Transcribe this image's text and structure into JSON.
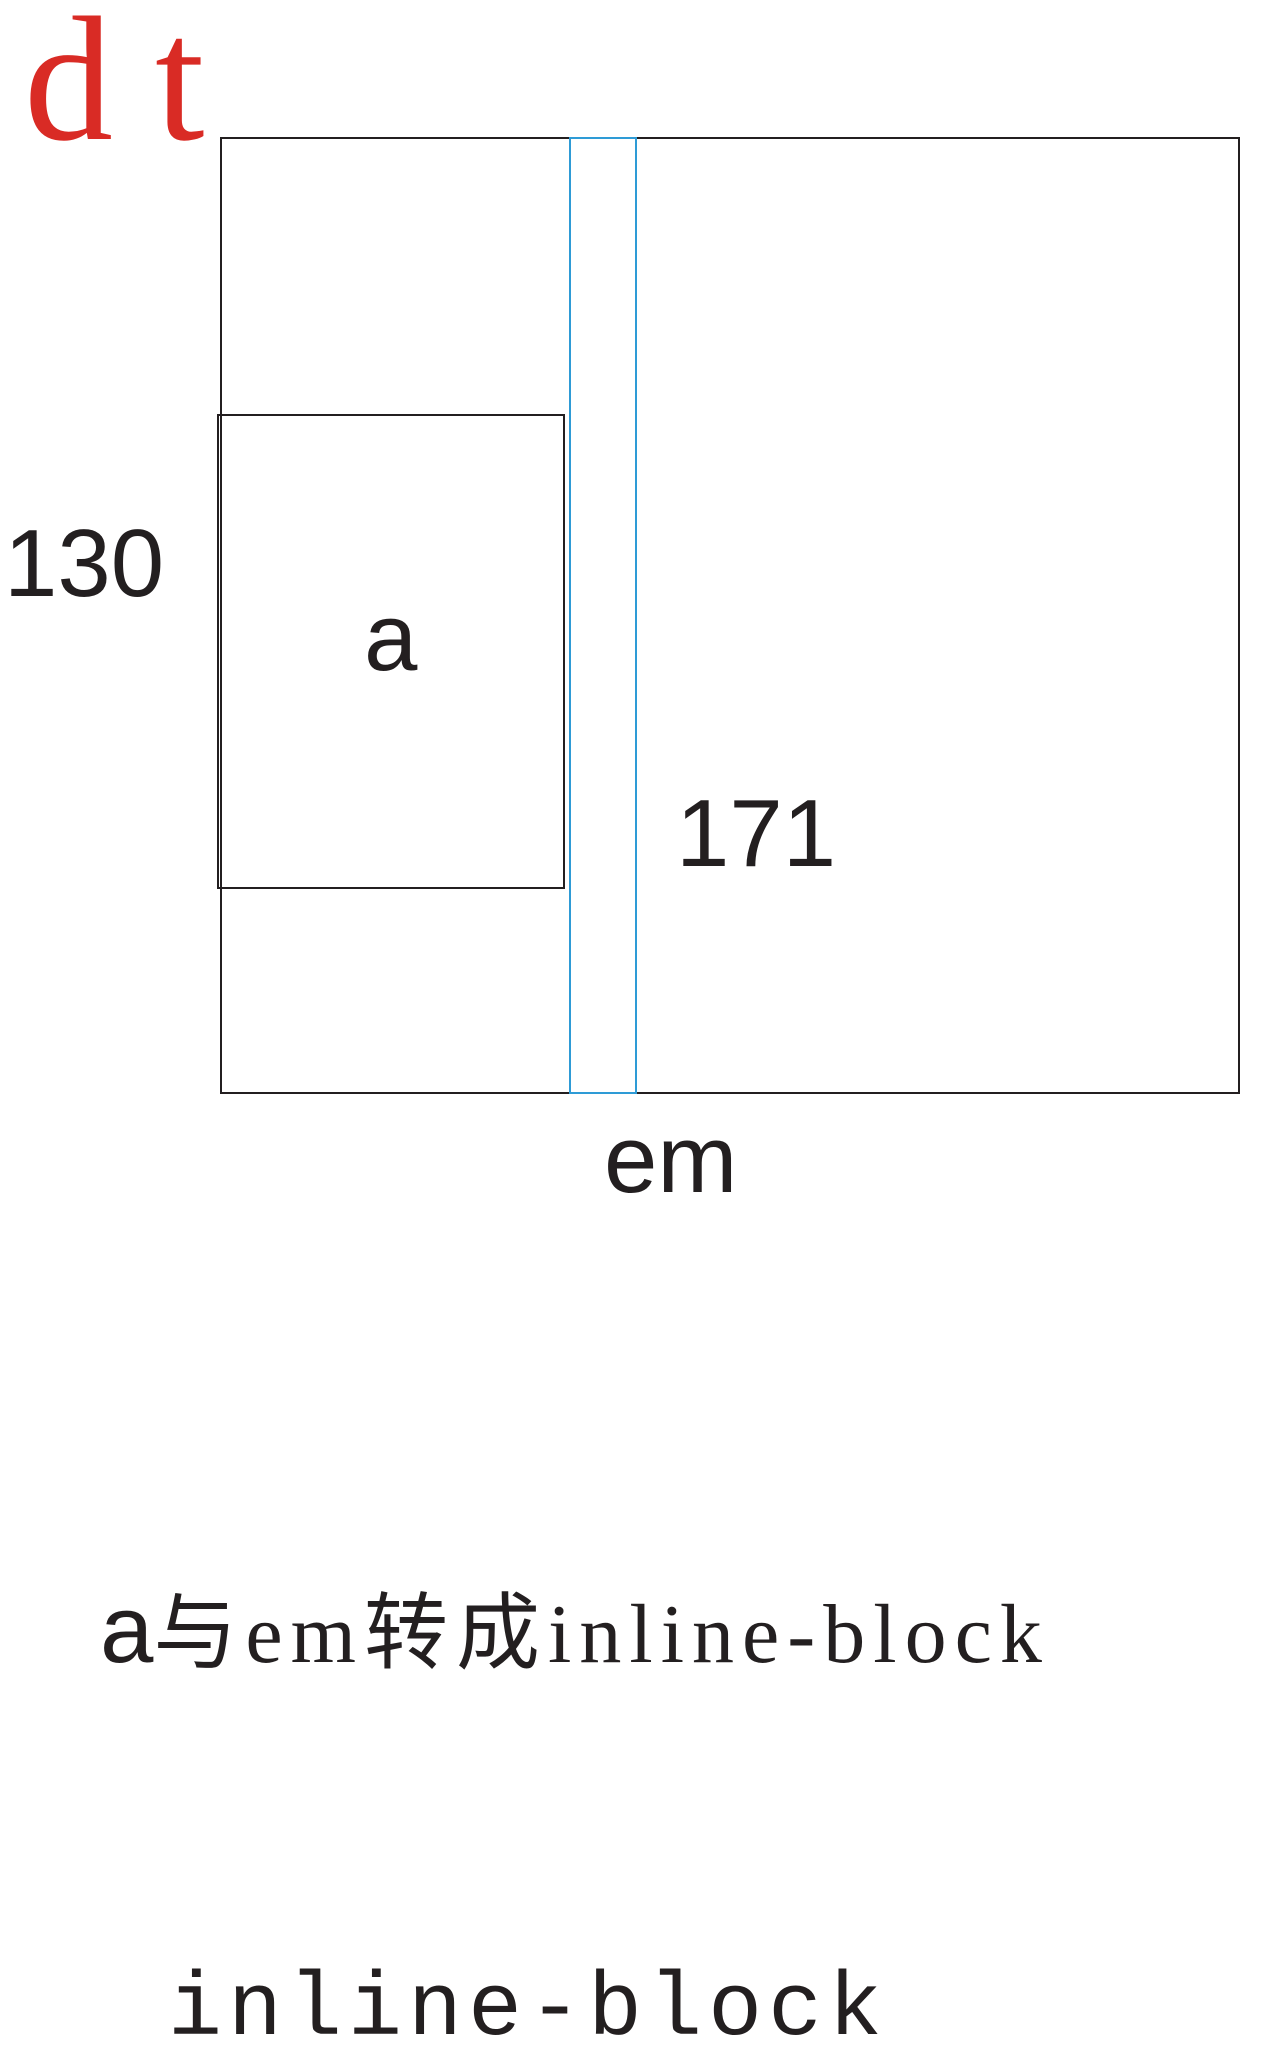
{
  "title": "dt",
  "labels": {
    "a_height": "130",
    "a_name": "a",
    "dt_height": "171",
    "em_name": "em"
  },
  "caption": {
    "lead": "a",
    "rest": "与em转成inline-block"
  },
  "caption2": "inline-block",
  "colors": {
    "title": "#d92b25",
    "em_strip": "#2e9bd6",
    "outline": "#231f20"
  }
}
